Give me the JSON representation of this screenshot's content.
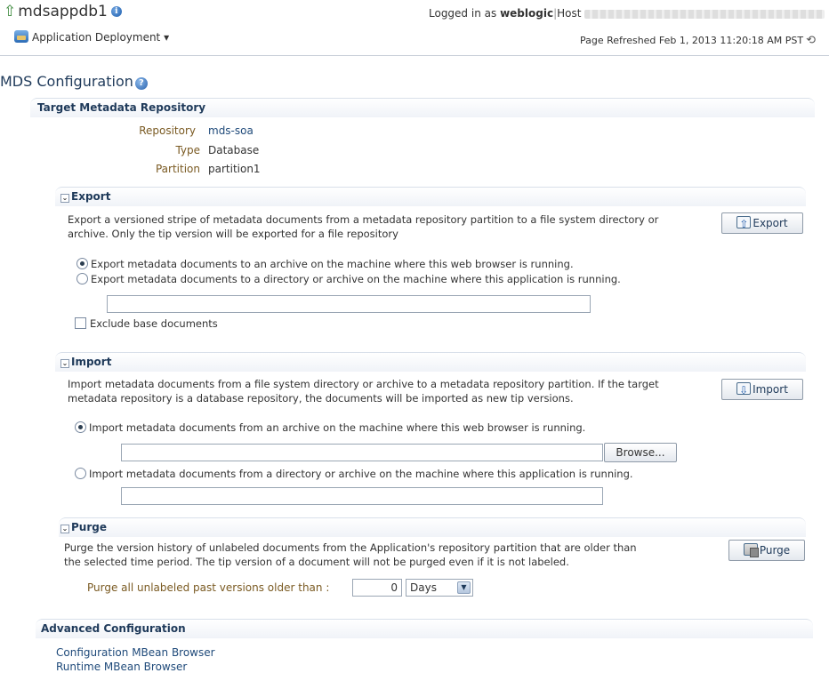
{
  "header": {
    "target_name": "mdsappdb1",
    "app_menu_label": "Application Deployment",
    "logged_in_prefix": "Logged in as",
    "user": "weblogic",
    "host_label": "Host",
    "refreshed": "Page Refreshed Feb 1, 2013 11:20:18 AM PST"
  },
  "page": {
    "title": "MDS Configuration"
  },
  "target_repo": {
    "heading": "Target Metadata Repository",
    "repository_label": "Repository",
    "repository_value": "mds-soa",
    "type_label": "Type",
    "type_value": "Database",
    "partition_label": "Partition",
    "partition_value": "partition1"
  },
  "export": {
    "heading": "Export",
    "desc_line1": "Export a versioned stripe of metadata documents from a metadata repository partition to a file system directory or",
    "desc_line2": "archive. Only the tip version will be exported for a file repository",
    "button": "Export",
    "option1": "Export metadata documents to an archive on the machine where this web browser is running.",
    "option2": "Export metadata documents to a directory or archive on the machine where this application is running.",
    "path_value": "",
    "exclude_label": "Exclude base documents"
  },
  "import": {
    "heading": "Import",
    "desc_line1": "Import metadata documents from a file system directory or archive to a metadata repository partition. If the target",
    "desc_line2": "metadata repository is a database repository, the documents will be imported as new tip versions.",
    "button": "Import",
    "option1": "Import metadata documents from an archive on the machine where this web browser is running.",
    "browse_button": "Browse...",
    "option2": "Import metadata documents from a directory or archive on the machine where this application is running.",
    "file_value": "",
    "path_value": ""
  },
  "purge": {
    "heading": "Purge",
    "desc_line1": "Purge the version history of unlabeled documents from the Application's repository partition that are older than",
    "desc_line2": "the selected time period. The tip version of a document will not be purged even if it is not labeled.",
    "button": "Purge",
    "older_than_label": "Purge all unlabeled past versions older than :",
    "amount_value": "0",
    "unit_value": "Days"
  },
  "advanced": {
    "heading": "Advanced Configuration",
    "link1": "Configuration MBean Browser",
    "link2": "Runtime MBean Browser"
  }
}
